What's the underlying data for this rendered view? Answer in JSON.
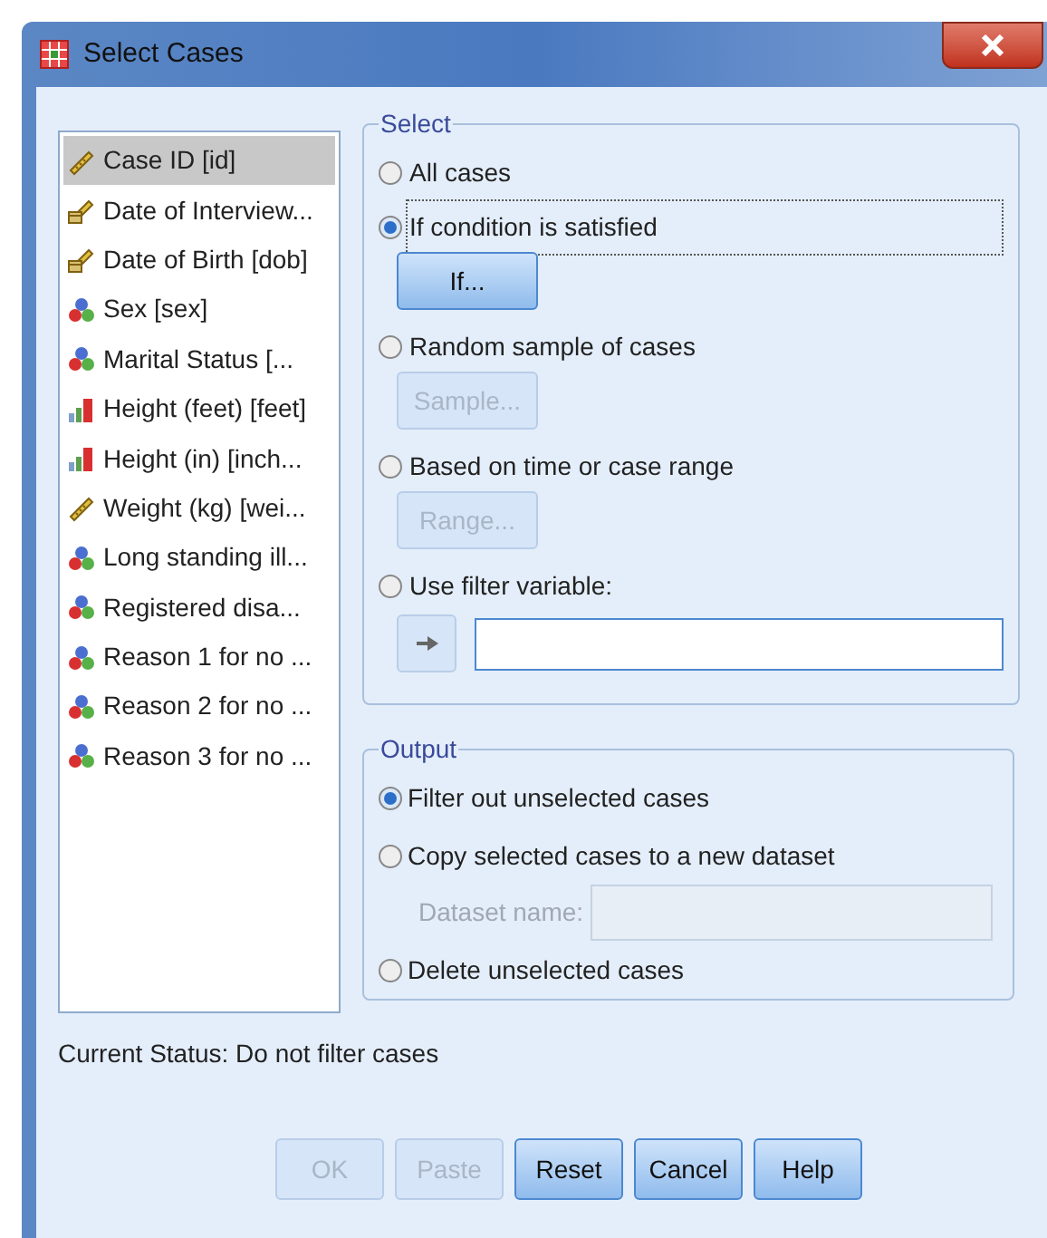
{
  "window": {
    "title": "Select Cases"
  },
  "variables": [
    {
      "label": "Case ID [id]",
      "kind": "scale",
      "selected": true
    },
    {
      "label": "Date of Interview...",
      "kind": "date",
      "selected": false
    },
    {
      "label": "Date of Birth [dob]",
      "kind": "date",
      "selected": false
    },
    {
      "label": "Sex [sex]",
      "kind": "nominal",
      "selected": false
    },
    {
      "label": "Marital Status [...",
      "kind": "nominal",
      "selected": false
    },
    {
      "label": "Height (feet) [feet]",
      "kind": "ordinal",
      "selected": false
    },
    {
      "label": "Height (in) [inch...",
      "kind": "ordinal",
      "selected": false
    },
    {
      "label": "Weight (kg) [wei...",
      "kind": "scale",
      "selected": false
    },
    {
      "label": "Long standing ill...",
      "kind": "nominal",
      "selected": false
    },
    {
      "label": "Registered disa...",
      "kind": "nominal",
      "selected": false
    },
    {
      "label": "Reason 1 for no ...",
      "kind": "nominal",
      "selected": false
    },
    {
      "label": "Reason 2 for no ...",
      "kind": "nominal",
      "selected": false
    },
    {
      "label": "Reason 3 for no ...",
      "kind": "nominal",
      "selected": false
    }
  ],
  "select": {
    "title": "Select",
    "options": [
      {
        "label": "All cases",
        "selected": false,
        "focused": false,
        "kind": "plain"
      },
      {
        "label": "If condition is satisfied",
        "selected": true,
        "focused": true,
        "kind": "button",
        "button": {
          "label": "If...",
          "disabled": false
        }
      },
      {
        "label": "Random sample of cases",
        "selected": false,
        "focused": false,
        "kind": "button",
        "button": {
          "label": "Sample...",
          "disabled": true
        }
      },
      {
        "label": "Based on time or case range",
        "selected": false,
        "focused": false,
        "kind": "button",
        "button": {
          "label": "Range...",
          "disabled": true
        }
      },
      {
        "label": "Use filter variable:",
        "selected": false,
        "focused": false,
        "kind": "variable"
      }
    ]
  },
  "output": {
    "title": "Output",
    "options": [
      {
        "label": "Filter out unselected cases",
        "selected": true,
        "kind": "plain"
      },
      {
        "label": "Copy selected cases to a new dataset",
        "selected": false,
        "kind": "dataset",
        "field": {
          "label": "Dataset name:",
          "disabled": true
        }
      },
      {
        "label": "Delete unselected cases",
        "selected": false,
        "kind": "plain"
      }
    ]
  },
  "status": "Current Status: Do not filter cases",
  "buttons": [
    {
      "label": "OK",
      "disabled": true
    },
    {
      "label": "Paste",
      "disabled": true
    },
    {
      "label": "Reset",
      "disabled": false
    },
    {
      "label": "Cancel",
      "disabled": false
    },
    {
      "label": "Help",
      "disabled": false
    }
  ]
}
